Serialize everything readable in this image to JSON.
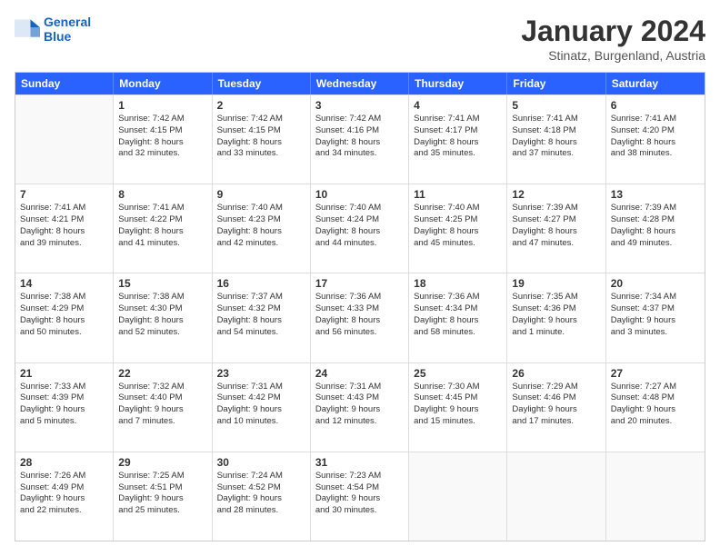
{
  "logo": {
    "line1": "General",
    "line2": "Blue"
  },
  "title": "January 2024",
  "subtitle": "Stinatz, Burgenland, Austria",
  "days": [
    "Sunday",
    "Monday",
    "Tuesday",
    "Wednesday",
    "Thursday",
    "Friday",
    "Saturday"
  ],
  "weeks": [
    [
      {
        "num": "",
        "info": ""
      },
      {
        "num": "1",
        "info": "Sunrise: 7:42 AM\nSunset: 4:15 PM\nDaylight: 8 hours\nand 32 minutes."
      },
      {
        "num": "2",
        "info": "Sunrise: 7:42 AM\nSunset: 4:15 PM\nDaylight: 8 hours\nand 33 minutes."
      },
      {
        "num": "3",
        "info": "Sunrise: 7:42 AM\nSunset: 4:16 PM\nDaylight: 8 hours\nand 34 minutes."
      },
      {
        "num": "4",
        "info": "Sunrise: 7:41 AM\nSunset: 4:17 PM\nDaylight: 8 hours\nand 35 minutes."
      },
      {
        "num": "5",
        "info": "Sunrise: 7:41 AM\nSunset: 4:18 PM\nDaylight: 8 hours\nand 37 minutes."
      },
      {
        "num": "6",
        "info": "Sunrise: 7:41 AM\nSunset: 4:20 PM\nDaylight: 8 hours\nand 38 minutes."
      }
    ],
    [
      {
        "num": "7",
        "info": "Sunrise: 7:41 AM\nSunset: 4:21 PM\nDaylight: 8 hours\nand 39 minutes."
      },
      {
        "num": "8",
        "info": "Sunrise: 7:41 AM\nSunset: 4:22 PM\nDaylight: 8 hours\nand 41 minutes."
      },
      {
        "num": "9",
        "info": "Sunrise: 7:40 AM\nSunset: 4:23 PM\nDaylight: 8 hours\nand 42 minutes."
      },
      {
        "num": "10",
        "info": "Sunrise: 7:40 AM\nSunset: 4:24 PM\nDaylight: 8 hours\nand 44 minutes."
      },
      {
        "num": "11",
        "info": "Sunrise: 7:40 AM\nSunset: 4:25 PM\nDaylight: 8 hours\nand 45 minutes."
      },
      {
        "num": "12",
        "info": "Sunrise: 7:39 AM\nSunset: 4:27 PM\nDaylight: 8 hours\nand 47 minutes."
      },
      {
        "num": "13",
        "info": "Sunrise: 7:39 AM\nSunset: 4:28 PM\nDaylight: 8 hours\nand 49 minutes."
      }
    ],
    [
      {
        "num": "14",
        "info": "Sunrise: 7:38 AM\nSunset: 4:29 PM\nDaylight: 8 hours\nand 50 minutes."
      },
      {
        "num": "15",
        "info": "Sunrise: 7:38 AM\nSunset: 4:30 PM\nDaylight: 8 hours\nand 52 minutes."
      },
      {
        "num": "16",
        "info": "Sunrise: 7:37 AM\nSunset: 4:32 PM\nDaylight: 8 hours\nand 54 minutes."
      },
      {
        "num": "17",
        "info": "Sunrise: 7:36 AM\nSunset: 4:33 PM\nDaylight: 8 hours\nand 56 minutes."
      },
      {
        "num": "18",
        "info": "Sunrise: 7:36 AM\nSunset: 4:34 PM\nDaylight: 8 hours\nand 58 minutes."
      },
      {
        "num": "19",
        "info": "Sunrise: 7:35 AM\nSunset: 4:36 PM\nDaylight: 9 hours\nand 1 minute."
      },
      {
        "num": "20",
        "info": "Sunrise: 7:34 AM\nSunset: 4:37 PM\nDaylight: 9 hours\nand 3 minutes."
      }
    ],
    [
      {
        "num": "21",
        "info": "Sunrise: 7:33 AM\nSunset: 4:39 PM\nDaylight: 9 hours\nand 5 minutes."
      },
      {
        "num": "22",
        "info": "Sunrise: 7:32 AM\nSunset: 4:40 PM\nDaylight: 9 hours\nand 7 minutes."
      },
      {
        "num": "23",
        "info": "Sunrise: 7:31 AM\nSunset: 4:42 PM\nDaylight: 9 hours\nand 10 minutes."
      },
      {
        "num": "24",
        "info": "Sunrise: 7:31 AM\nSunset: 4:43 PM\nDaylight: 9 hours\nand 12 minutes."
      },
      {
        "num": "25",
        "info": "Sunrise: 7:30 AM\nSunset: 4:45 PM\nDaylight: 9 hours\nand 15 minutes."
      },
      {
        "num": "26",
        "info": "Sunrise: 7:29 AM\nSunset: 4:46 PM\nDaylight: 9 hours\nand 17 minutes."
      },
      {
        "num": "27",
        "info": "Sunrise: 7:27 AM\nSunset: 4:48 PM\nDaylight: 9 hours\nand 20 minutes."
      }
    ],
    [
      {
        "num": "28",
        "info": "Sunrise: 7:26 AM\nSunset: 4:49 PM\nDaylight: 9 hours\nand 22 minutes."
      },
      {
        "num": "29",
        "info": "Sunrise: 7:25 AM\nSunset: 4:51 PM\nDaylight: 9 hours\nand 25 minutes."
      },
      {
        "num": "30",
        "info": "Sunrise: 7:24 AM\nSunset: 4:52 PM\nDaylight: 9 hours\nand 28 minutes."
      },
      {
        "num": "31",
        "info": "Sunrise: 7:23 AM\nSunset: 4:54 PM\nDaylight: 9 hours\nand 30 minutes."
      },
      {
        "num": "",
        "info": ""
      },
      {
        "num": "",
        "info": ""
      },
      {
        "num": "",
        "info": ""
      }
    ]
  ]
}
